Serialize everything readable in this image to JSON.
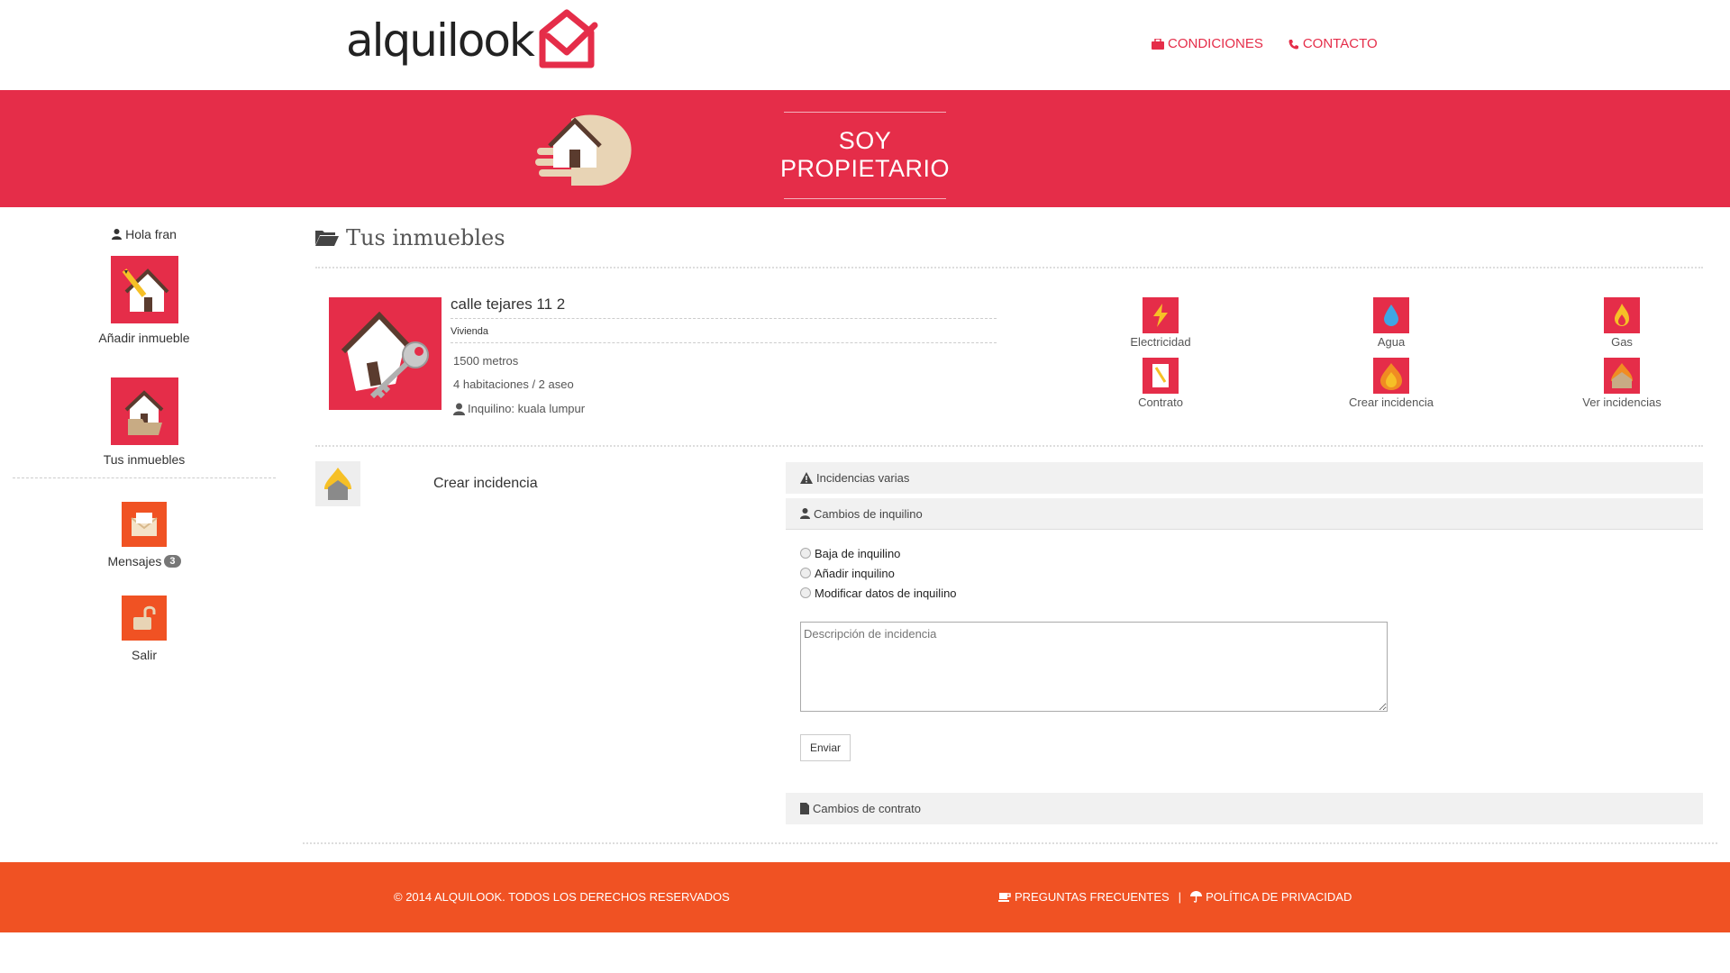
{
  "header": {
    "logo_text": "alquilook",
    "links": [
      {
        "label": "CONDICIONES",
        "icon": "briefcase-icon"
      },
      {
        "label": "CONTACTO",
        "icon": "phone-icon"
      }
    ]
  },
  "banner": {
    "title": "SOY PROPIETARIO",
    "icon": "hand-house-icon"
  },
  "sidebar": {
    "greeting": "Hola fran",
    "items": [
      {
        "label": "Añadir inmueble",
        "icon": "add-house-icon"
      },
      {
        "label": "Tus inmuebles",
        "icon": "house-folder-icon"
      },
      {
        "label": "Mensajes",
        "icon": "envelope-icon",
        "badge": "3"
      },
      {
        "label": "Salir",
        "icon": "padlock-icon"
      }
    ]
  },
  "main": {
    "section_title": "Tus inmuebles",
    "property": {
      "title": "calle tejares 11 2",
      "type": "Vivienda",
      "size": "1500 metros",
      "rooms": "4 habitaciones / 2 aseo",
      "tenant": "Inquilino: kuala lumpur"
    },
    "actions": [
      {
        "label": "Electricidad",
        "icon": "lightning-icon"
      },
      {
        "label": "Agua",
        "icon": "water-drop-icon"
      },
      {
        "label": "Gas",
        "icon": "flame-icon"
      },
      {
        "label": "Contrato",
        "icon": "contract-icon"
      },
      {
        "label": "Crear incidencia",
        "icon": "fire-icon"
      },
      {
        "label": "Ver incidencias",
        "icon": "house-fire-icon"
      }
    ],
    "incidence": {
      "title": "Crear incidencia",
      "accordion": [
        {
          "label": "Incidencias varias",
          "icon": "warning-icon"
        },
        {
          "label": "Cambios de inquilino",
          "icon": "user-icon"
        },
        {
          "label": "Cambios de contrato",
          "icon": "document-icon"
        }
      ],
      "options": [
        "Baja de inquilino",
        "Añadir inquilino",
        "Modificar datos de inquilino"
      ],
      "textarea_placeholder": "Descripción de incidencia",
      "send_label": "Enviar"
    }
  },
  "footer": {
    "copyright": "© 2014 ALQUILOOK. TODOS LOS DERECHOS RESERVADOS",
    "links": [
      {
        "label": "PREGUNTAS FRECUENTES",
        "icon": "coffee-icon"
      },
      {
        "label": "POLÍTICA DE PRIVACIDAD",
        "icon": "umbrella-icon"
      }
    ],
    "separator": "|"
  },
  "colors": {
    "brand_red": "#e52d49",
    "brand_orange": "#f05223"
  }
}
